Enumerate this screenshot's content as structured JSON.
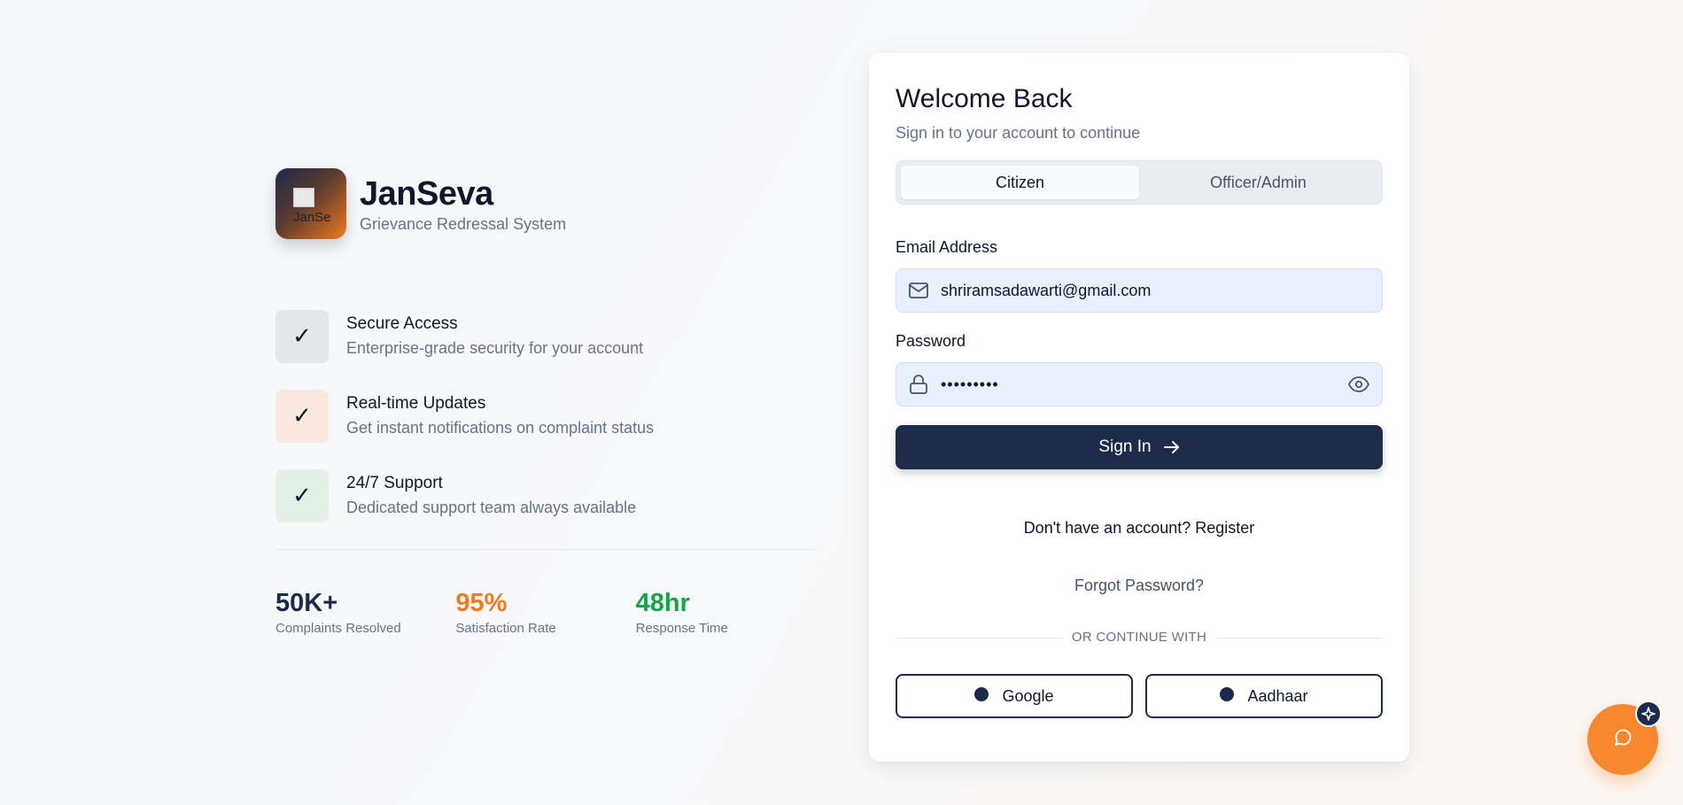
{
  "brand": {
    "logo_alt": "JanSeva",
    "title": "JanSeva",
    "subtitle": "Grievance Redressal System"
  },
  "features": [
    {
      "title": "Secure Access",
      "description": "Enterprise-grade security for your account",
      "check": "✓",
      "bg": "#e3e6eb"
    },
    {
      "title": "Real-time Updates",
      "description": "Get instant notifications on complaint status",
      "check": "✓",
      "bg": "#f8e8de"
    },
    {
      "title": "24/7 Support",
      "description": "Dedicated support team always available",
      "check": "✓",
      "bg": "#e3f0e6"
    }
  ],
  "stats": [
    {
      "value": "50K+",
      "label": "Complaints Resolved",
      "color": "#1e2a4a"
    },
    {
      "value": "95%",
      "label": "Satisfaction Rate",
      "color": "#f07a1f"
    },
    {
      "value": "48hr",
      "label": "Response Time",
      "color": "#16a34a"
    }
  ],
  "login": {
    "title": "Welcome Back",
    "subtitle": "Sign in to your account to continue",
    "tabs": [
      {
        "label": "Citizen",
        "active": true
      },
      {
        "label": "Officer/Admin",
        "active": false
      }
    ],
    "email_label": "Email Address",
    "email_value": "shriramsadawarti@gmail.com",
    "password_label": "Password",
    "password_value": "•••••••••",
    "signin_label": "Sign In",
    "register_text": "Don't have an account? Register",
    "forgot_text": "Forgot Password?",
    "or_text": "OR CONTINUE WITH",
    "social": [
      {
        "label": "Google"
      },
      {
        "label": "Aadhaar"
      }
    ]
  },
  "icons": {
    "mail": "mail-icon",
    "lock": "lock-icon",
    "eye": "eye-icon",
    "arrow": "arrow-right-icon",
    "chat": "chat-icon",
    "sparkle": "sparkle-icon"
  },
  "colors": {
    "navy": "#1e2a4a",
    "orange": "#f07a1f",
    "green": "#16a34a",
    "input_bg": "#e8f0fe"
  }
}
